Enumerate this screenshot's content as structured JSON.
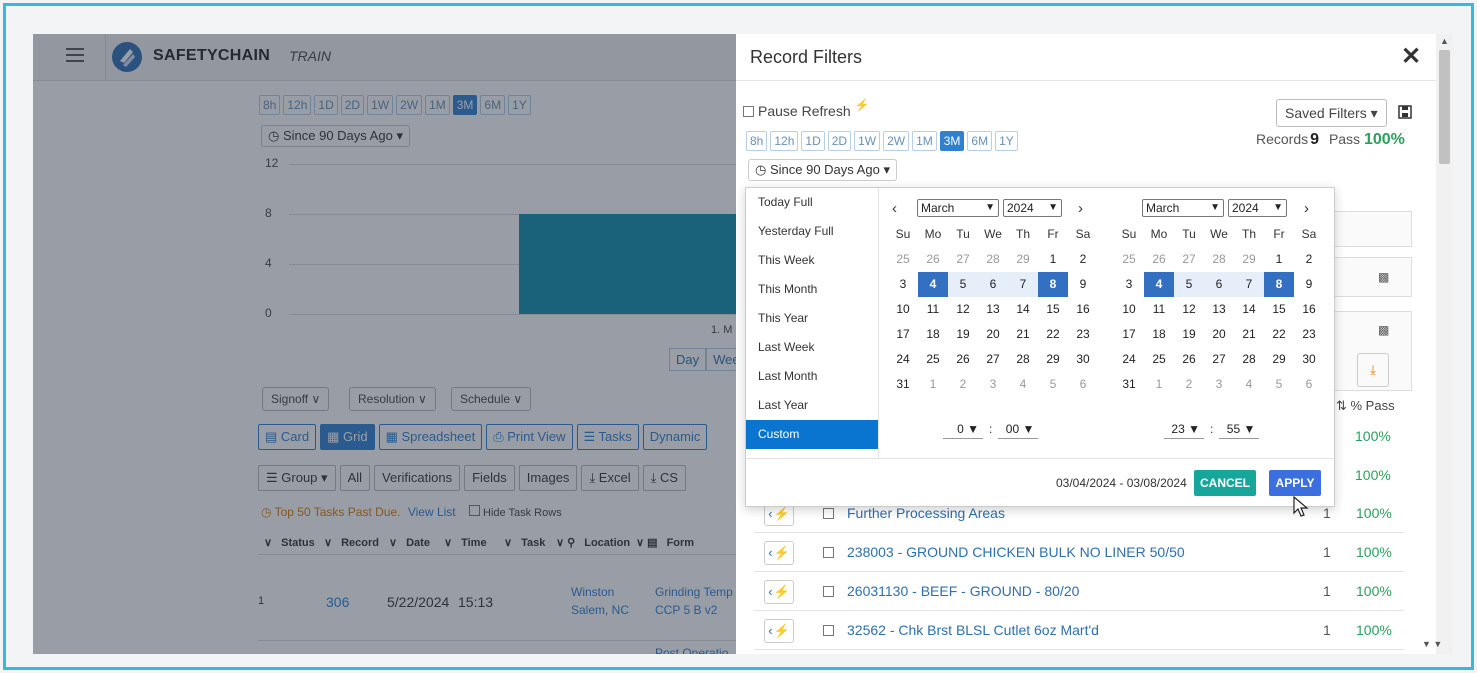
{
  "app": {
    "brand": "SAFETYCHAIN",
    "env": "TRAIN",
    "time_chips": [
      "8h",
      "12h",
      "1D",
      "2D",
      "1W",
      "2W",
      "1M",
      "3M",
      "6M",
      "1Y"
    ],
    "time_chip_active": "3M",
    "since_label": "Since 90 Days Ago",
    "chart_data": {
      "type": "bar",
      "y_ticks": [
        "12",
        "8",
        "4",
        "0"
      ],
      "ylim": [
        0,
        12
      ],
      "categories": [
        "1. M"
      ],
      "values": [
        8
      ],
      "category_label": "1. M"
    },
    "view_segments": [
      "Day",
      "Wee"
    ],
    "dropdowns": [
      "Signoff",
      "Resolution",
      "Schedule"
    ],
    "view_tabs": [
      "Card",
      "Grid",
      "Spreadsheet",
      "Print View",
      "Tasks",
      "Dynamic"
    ],
    "toolbar": [
      "Group",
      "All",
      "Verifications",
      "Fields",
      "Images",
      "Excel",
      "CS"
    ],
    "past_due": "Top 50 Tasks Past Due.",
    "view_list": "View List",
    "hide_task_rows": "Hide Task Rows",
    "table_headers": [
      "Status",
      "Record",
      "Date",
      "Time",
      "Task",
      "Location",
      "Form"
    ],
    "row": {
      "index": "1",
      "record": "306",
      "date": "5/22/2024",
      "time": "15:13",
      "location_line1": "Winston",
      "location_line2": "Salem, NC",
      "form_line1": "Grinding Temp",
      "form_line2": "CCP 5 B v2",
      "next_form": "Post Operatio"
    }
  },
  "panel": {
    "title": "Record Filters",
    "pause_refresh": "Pause Refresh",
    "saved_filters": "Saved Filters",
    "records_label": "Records",
    "records_count": "9",
    "pass_label": "Pass",
    "pass_value": "100%",
    "time_chips": [
      "8h",
      "12h",
      "1D",
      "2D",
      "1W",
      "2W",
      "1M",
      "3M",
      "6M",
      "1Y"
    ],
    "since_label": "Since 90 Days Ago",
    "pass_column_header": "% Pass",
    "pass_column_values": [
      "100%",
      "100%"
    ],
    "list_rows": [
      {
        "name": "Further Processing Areas",
        "count": "1",
        "pass": "100%"
      },
      {
        "name": "238003 - GROUND CHICKEN BULK NO LINER 50/50",
        "count": "1",
        "pass": "100%"
      },
      {
        "name": "26031130 - BEEF - GROUND - 80/20",
        "count": "1",
        "pass": "100%"
      },
      {
        "name": "32562 - Chk Brst BLSL Cutlet 6oz Mart'd",
        "count": "1",
        "pass": "100%"
      }
    ]
  },
  "picker": {
    "ranges": [
      "Today Full",
      "Yesterday Full",
      "This Week",
      "This Month",
      "This Year",
      "Last Week",
      "Last Month",
      "Last Year",
      "Custom"
    ],
    "active_range": "Custom",
    "weekdays": [
      "Su",
      "Mo",
      "Tu",
      "We",
      "Th",
      "Fr",
      "Sa"
    ],
    "left": {
      "month": "March",
      "year": "2024",
      "hour": "0",
      "minute": "00"
    },
    "right": {
      "month": "March",
      "year": "2024",
      "hour": "23",
      "minute": "55"
    },
    "days": [
      "25",
      "26",
      "27",
      "28",
      "29",
      "1",
      "2",
      "3",
      "4",
      "5",
      "6",
      "7",
      "8",
      "9",
      "10",
      "11",
      "12",
      "13",
      "14",
      "15",
      "16",
      "17",
      "18",
      "19",
      "20",
      "21",
      "22",
      "23",
      "24",
      "25",
      "26",
      "27",
      "28",
      "29",
      "30",
      "31",
      "1",
      "2",
      "3",
      "4",
      "5",
      "6"
    ],
    "selected_start": "4",
    "selected_end": "8",
    "date_range_text": "03/04/2024 - 03/08/2024",
    "cancel_label": "CANCEL",
    "apply_label": "APPLY"
  }
}
